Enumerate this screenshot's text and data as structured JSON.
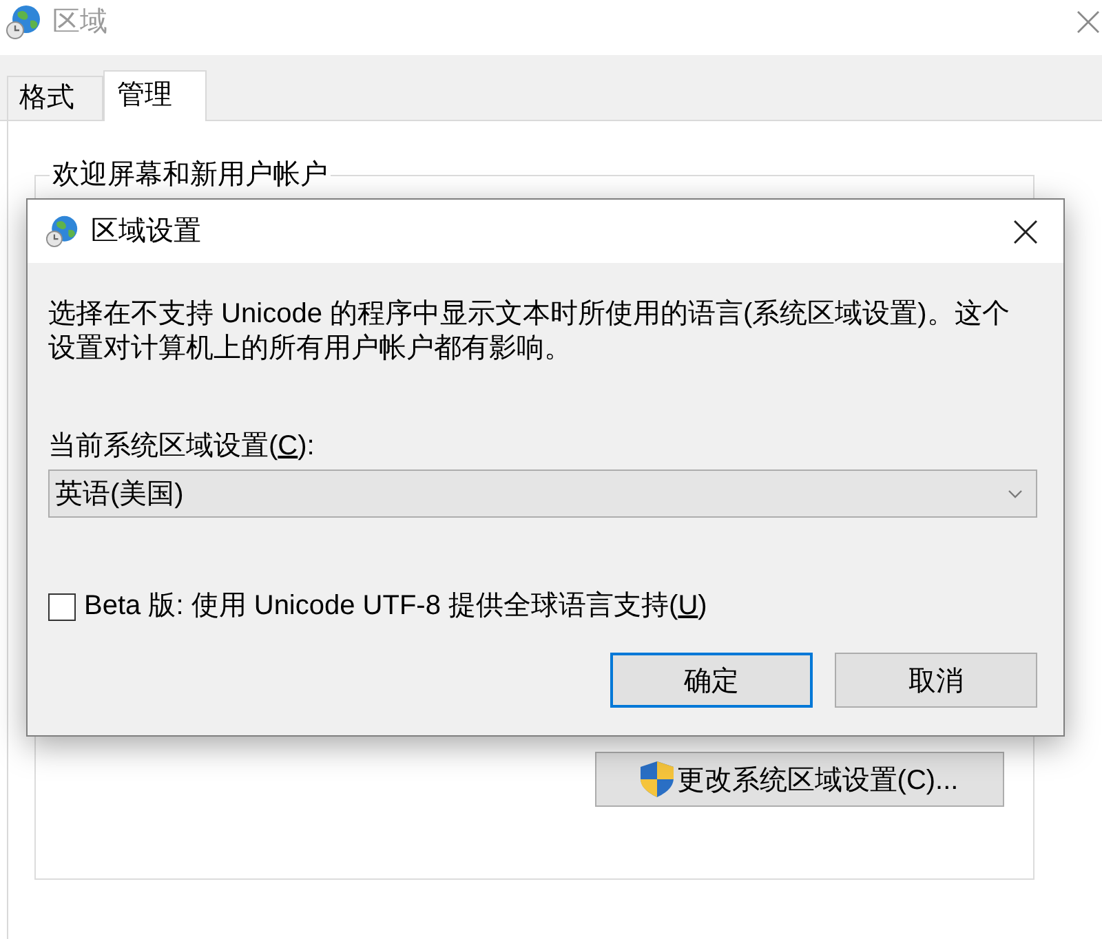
{
  "window": {
    "title": "区域"
  },
  "tabs": [
    {
      "label": "格式",
      "selected": false
    },
    {
      "label": "管理",
      "selected": true
    }
  ],
  "group": {
    "title": "欢迎屏幕和新用户帐户",
    "button": {
      "label": "更改系统区域设置(C)..."
    }
  },
  "dialog": {
    "title": "区域设置",
    "description": "选择在不支持 Unicode 的程序中显示文本时所使用的语言(系统区域设置)。这个设置对计算机上的所有用户帐户都有影响。",
    "locale_label": {
      "prefix": "当前系统区域设置(",
      "access_key": "C",
      "suffix": "):"
    },
    "locale_select": {
      "value": "英语(美国)"
    },
    "beta_option": {
      "checked": false,
      "label": {
        "prefix": "Beta 版: 使用 Unicode UTF-8 提供全球语言支持(",
        "access_key": "U",
        "suffix": ")"
      }
    },
    "buttons": [
      {
        "label": "确定",
        "default": true
      },
      {
        "label": "取消",
        "default": false
      }
    ]
  }
}
